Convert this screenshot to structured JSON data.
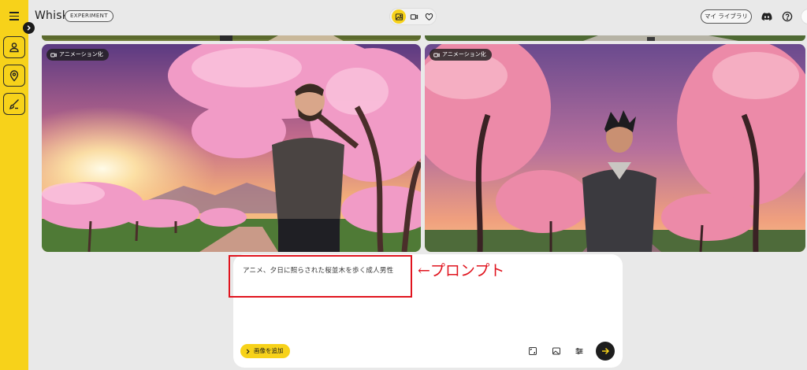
{
  "app": {
    "title": "Whisk",
    "badge": "EXPERIMENT"
  },
  "header": {
    "modes": [
      {
        "icon": "image-icon",
        "active": true
      },
      {
        "icon": "video-icon",
        "active": false
      },
      {
        "icon": "heart-icon",
        "active": false
      }
    ],
    "library_label": "マイ ライブラリ",
    "icons": [
      "discord-icon",
      "help-icon"
    ]
  },
  "sidebar": {
    "tools": [
      "subject-person-icon",
      "scene-location-icon",
      "style-brush-icon"
    ]
  },
  "tiles": [
    {
      "chip_label": "アニメーション化"
    },
    {
      "chip_label": "アニメーション化"
    }
  ],
  "prompt": {
    "text": "アニメ、夕日に照らされた桜並木を歩く成人男性",
    "add_image_label": "画像を追加",
    "tools": [
      "aspect-ratio-icon",
      "image-frame-icon",
      "settings-sliders-icon"
    ],
    "send_icon": "arrow-right-icon"
  },
  "annotation": {
    "label": "←プロンプト",
    "color": "#e0141e"
  },
  "colors": {
    "accent": "#f7d21a",
    "background": "#e9e9e9",
    "panel": "#ffffff"
  }
}
